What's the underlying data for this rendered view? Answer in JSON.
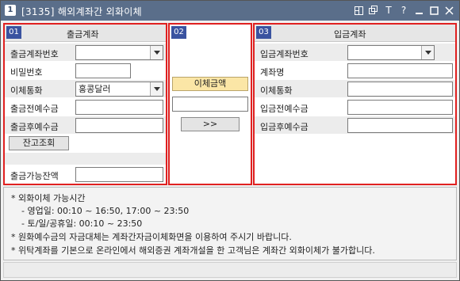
{
  "window": {
    "icon_label": "1",
    "title": "[3135] 해외계좌간 외화이체"
  },
  "title_tools": [
    "window-layout-icon",
    "copy-icon",
    "font-icon",
    "help-icon",
    "minimize-icon",
    "maximize-icon",
    "close-icon"
  ],
  "title_tool_glyphs": {
    "font": "T",
    "help": "?"
  },
  "panel1": {
    "num": "01",
    "title": "출금계좌",
    "rows": {
      "account_label": "출금계좌번호",
      "password_label": "비밀번호",
      "currency_label": "이체통화",
      "currency_value": "홍콩달러",
      "before_label": "출금전예수금",
      "after_label": "출금후예수금",
      "balance_btn": "잔고조회",
      "avail_label": "출금가능잔액"
    }
  },
  "panel2": {
    "num": "02",
    "amount_label": "이체금액",
    "transfer_btn": ">>"
  },
  "panel3": {
    "num": "03",
    "title": "입금계좌",
    "rows": {
      "account_label": "입금계좌번호",
      "name_label": "계좌명",
      "currency_label": "이체통화",
      "before_label": "입금전예수금",
      "after_label": "입금후예수금"
    }
  },
  "notes": {
    "l1": "* 외화이체 가능시간",
    "l2": "- 영업일: 00:10 ~ 16:50, 17:00 ~ 23:50",
    "l3": "- 토/일/공휴일: 00:10 ~ 23:50",
    "l4": "* 원화예수금의 자금대체는 계좌간자금이체화면을 이용하여 주시기 바랍니다.",
    "l5": "* 위탁계좌를 기본으로 온라인에서 해외증권 계좌개설을 한 고객님은 계좌간 외화이체가 불가합니다."
  },
  "colors": {
    "titlebar": "#5a6e8a",
    "panel_border": "#e02020",
    "panel_num_bg": "#3a53a0",
    "amount_label_bg": "#fbe6a6"
  }
}
